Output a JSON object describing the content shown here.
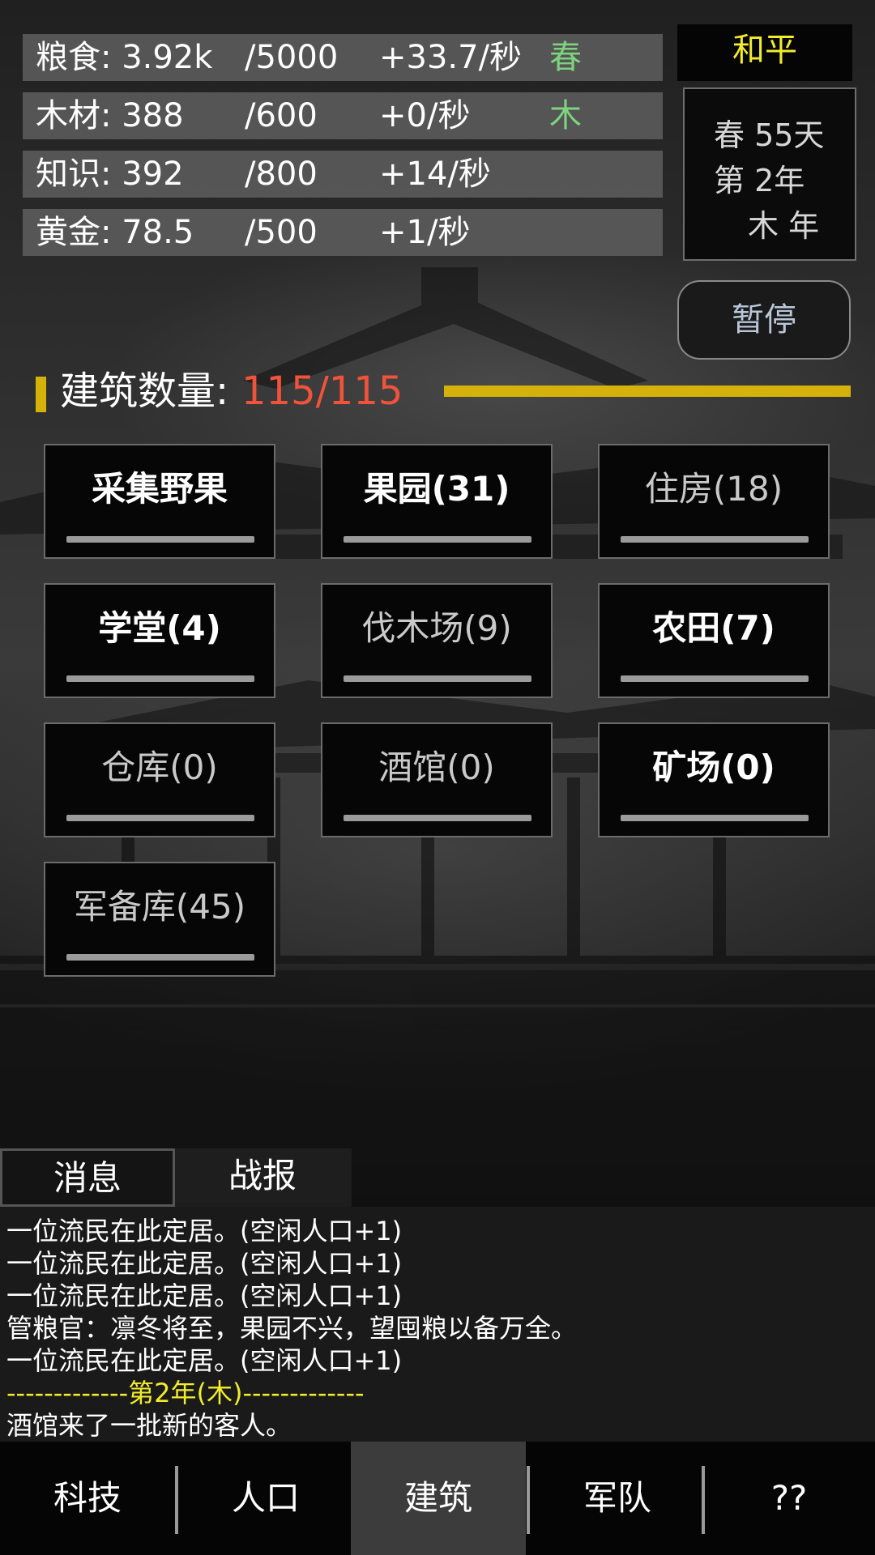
{
  "resources": [
    {
      "name": "粮食: 3.92k",
      "cap": "/5000",
      "rate": "+33.7/秒",
      "tag": "春"
    },
    {
      "name": "木材: 388",
      "cap": "/600",
      "rate": "+0/秒",
      "tag": "木"
    },
    {
      "name": "知识: 392",
      "cap": "/800",
      "rate": "+14/秒",
      "tag": ""
    },
    {
      "name": "黄金: 78.5",
      "cap": "/500",
      "rate": "+1/秒",
      "tag": ""
    }
  ],
  "status": {
    "peace": "和平",
    "season_day": "春 55天",
    "year": "第 2年",
    "element_year": "木 年",
    "pause_label": "暂停"
  },
  "building_count": {
    "label": "建筑数量:",
    "value": "115/115"
  },
  "buildings": [
    {
      "label": "采集野果",
      "dim": false
    },
    {
      "label": "果园(31)",
      "dim": false
    },
    {
      "label": "住房(18)",
      "dim": true
    },
    {
      "label": "学堂(4)",
      "dim": false
    },
    {
      "label": "伐木场(9)",
      "dim": true
    },
    {
      "label": "农田(7)",
      "dim": false
    },
    {
      "label": "仓库(0)",
      "dim": true
    },
    {
      "label": "酒馆(0)",
      "dim": true
    },
    {
      "label": "矿场(0)",
      "dim": false
    },
    {
      "label": "军备库(45)",
      "dim": true
    }
  ],
  "tabs": {
    "messages": "消息",
    "battle": "战报"
  },
  "log": [
    "一位流民在此定居。(空闲人口+1)",
    "一位流民在此定居。(空闲人口+1)",
    "一位流民在此定居。(空闲人口+1)",
    "管粮官：凛冬将至，果园不兴，望囤粮以备万全。",
    "一位流民在此定居。(空闲人口+1)",
    "-------------第2年(木)-------------",
    "酒馆来了一批新的客人。"
  ],
  "nav": [
    "科技",
    "人口",
    "建筑",
    "军队",
    "??"
  ],
  "nav_active": 2,
  "colors": {
    "accent_yellow": "#f2ec2a",
    "count_red": "#f0533a",
    "season_green": "#7ed37e",
    "bar_gold": "#d4b20a"
  }
}
